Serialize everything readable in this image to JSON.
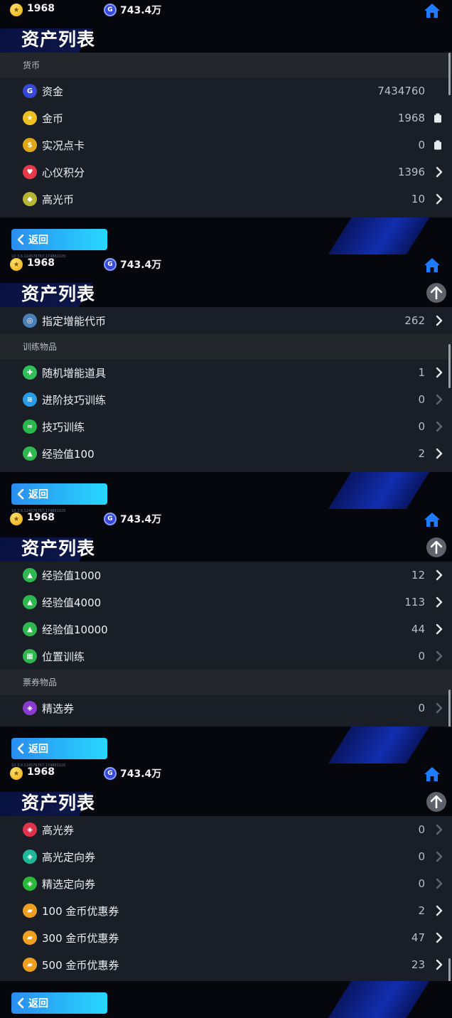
{
  "topbar": {
    "gold_value": "1968",
    "g_value": "743.4万",
    "version": "10.3.0.124576767.174881020"
  },
  "title": "资产列表",
  "back_label": "返回",
  "panels": [
    {
      "rows": [
        {
          "kind": "section",
          "label": "货币"
        },
        {
          "kind": "item",
          "label": "资金",
          "value": "7434760",
          "icon": "g-coin-icon",
          "action": "none"
        },
        {
          "kind": "item",
          "label": "金币",
          "value": "1968",
          "icon": "gold-coin-icon",
          "action": "clipboard"
        },
        {
          "kind": "item",
          "label": "实况点卡",
          "value": "0",
          "icon": "point-card-icon",
          "action": "clipboard"
        },
        {
          "kind": "item",
          "label": "心仪积分",
          "value": "1396",
          "icon": "heart-points-icon",
          "action": "chevron"
        },
        {
          "kind": "item",
          "label": "高光币",
          "value": "10",
          "icon": "highlight-coin-icon",
          "action": "chevron"
        }
      ]
    },
    {
      "rows": [
        {
          "kind": "item",
          "label": "指定增能代币",
          "value": "262",
          "icon": "boost-token-icon",
          "action": "chevron"
        },
        {
          "kind": "section",
          "label": "训练物品"
        },
        {
          "kind": "item",
          "label": "随机增能道具",
          "value": "1",
          "icon": "random-boost-icon",
          "action": "chevron"
        },
        {
          "kind": "item",
          "label": "进阶技巧训练",
          "value": "0",
          "icon": "advanced-skill-icon",
          "action": "chevron-dim"
        },
        {
          "kind": "item",
          "label": "技巧训练",
          "value": "0",
          "icon": "skill-training-icon",
          "action": "chevron-dim"
        },
        {
          "kind": "item",
          "label": "经验值100",
          "value": "2",
          "icon": "exp-icon",
          "action": "chevron"
        }
      ]
    },
    {
      "rows": [
        {
          "kind": "item",
          "label": "经验值1000",
          "value": "12",
          "icon": "exp-icon",
          "action": "chevron"
        },
        {
          "kind": "item",
          "label": "经验值4000",
          "value": "113",
          "icon": "exp-icon",
          "action": "chevron"
        },
        {
          "kind": "item",
          "label": "经验值10000",
          "value": "44",
          "icon": "exp-icon",
          "action": "chevron"
        },
        {
          "kind": "item",
          "label": "位置训练",
          "value": "0",
          "icon": "position-training-icon",
          "action": "chevron-dim"
        },
        {
          "kind": "section",
          "label": "票券物品"
        },
        {
          "kind": "item",
          "label": "精选券",
          "value": "0",
          "icon": "select-ticket-icon",
          "action": "chevron-dim"
        }
      ]
    },
    {
      "rows": [
        {
          "kind": "item",
          "label": "高光券",
          "value": "0",
          "icon": "highlight-ticket-icon",
          "action": "chevron-dim"
        },
        {
          "kind": "item",
          "label": "高光定向券",
          "value": "0",
          "icon": "highlight-targeted-ticket-icon",
          "action": "chevron-dim"
        },
        {
          "kind": "item",
          "label": "精选定向券",
          "value": "0",
          "icon": "select-targeted-ticket-icon",
          "action": "chevron-dim"
        },
        {
          "kind": "item",
          "label": "100 金币优惠券",
          "value": "2",
          "icon": "coupon-icon",
          "action": "chevron"
        },
        {
          "kind": "item",
          "label": "300 金币优惠券",
          "value": "47",
          "icon": "coupon-icon",
          "action": "chevron"
        },
        {
          "kind": "item",
          "label": "500 金币优惠券",
          "value": "23",
          "icon": "coupon-icon",
          "action": "chevron"
        }
      ]
    }
  ],
  "icon_colors": {
    "g-coin-icon": "#3848d6",
    "gold-coin-icon": "#f0c020",
    "point-card-icon": "#e0a817",
    "heart-points-icon": "#e8394a",
    "highlight-coin-icon": "#b6b634",
    "boost-token-icon": "#4a7fb8",
    "random-boost-icon": "#2fc05a",
    "advanced-skill-icon": "#2a9be8",
    "skill-training-icon": "#28b84c",
    "exp-icon": "#2fb84f",
    "position-training-icon": "#2fb84f",
    "select-ticket-icon": "#8a3ad0",
    "highlight-ticket-icon": "#e0324c",
    "highlight-targeted-ticket-icon": "#1fb89a",
    "select-targeted-ticket-icon": "#2cb83a",
    "coupon-icon": "#f0a020"
  },
  "icon_glyphs": {
    "g-coin-icon": "G",
    "gold-coin-icon": "★",
    "point-card-icon": "$",
    "heart-points-icon": "♥",
    "highlight-coin-icon": "◆",
    "boost-token-icon": "◎",
    "random-boost-icon": "✚",
    "advanced-skill-icon": "≋",
    "skill-training-icon": "≈",
    "exp-icon": "▲",
    "position-training-icon": "▦",
    "select-ticket-icon": "◈",
    "highlight-ticket-icon": "◈",
    "highlight-targeted-ticket-icon": "◈",
    "select-targeted-ticket-icon": "◈",
    "coupon-icon": "▰"
  }
}
